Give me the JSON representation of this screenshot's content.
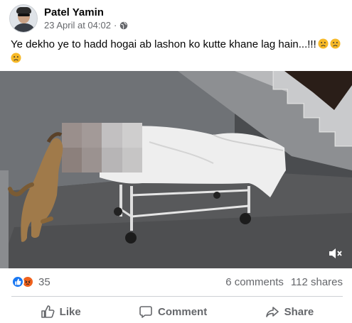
{
  "post": {
    "author": "Patel Yamin",
    "timestamp": "23 April at 04:02",
    "separator": "·",
    "privacy_icon": "globe-icon",
    "text": "Ye dekho ye to hadd hogai ab lashon ko kutte khane lag hain...!!!",
    "emoji": "sad-face-emoji"
  },
  "media": {
    "type": "video",
    "mute_icon": "volume-muted-icon"
  },
  "stats": {
    "reaction_count": "35",
    "reactions": [
      "like",
      "angry"
    ],
    "comments": "6 comments",
    "shares": "112 shares"
  },
  "actions": {
    "like_label": "Like",
    "comment_label": "Comment",
    "share_label": "Share"
  },
  "colors": {
    "like_blue": "#1877f2",
    "angry_orange": "#f0611c",
    "secondary_text": "#65676b"
  }
}
